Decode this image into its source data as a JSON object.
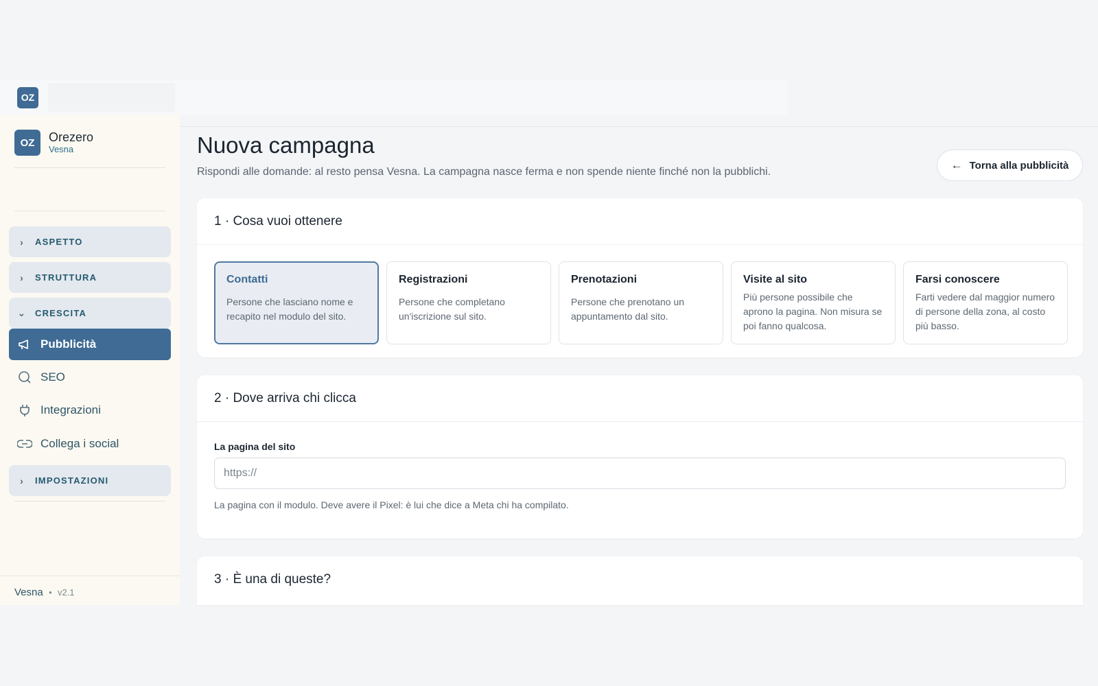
{
  "topbar": {
    "logo": "OZ"
  },
  "sidebar": {
    "brand": {
      "logo": "OZ",
      "name": "Orezero",
      "sub": "Vesna"
    },
    "groups": [
      {
        "label": "ASPETTO",
        "icon": "chevron-right-icon"
      },
      {
        "label": "STRUTTURA",
        "icon": "chevron-right-icon"
      },
      {
        "label": "CRESCITA",
        "icon": "chevron-down-icon"
      },
      {
        "label": "IMPOSTAZIONI",
        "icon": "chevron-right-icon"
      }
    ],
    "items": [
      {
        "label": "Pubblicità",
        "icon": "megaphone-icon",
        "active": true
      },
      {
        "label": "SEO",
        "icon": "search-icon"
      },
      {
        "label": "Integrazioni",
        "icon": "plug-icon"
      },
      {
        "label": "Collega i social",
        "icon": "link-icon"
      }
    ],
    "footer": {
      "app": "Vesna",
      "sep": "•",
      "version": "v2.1"
    }
  },
  "main": {
    "title": "Nuova campagna",
    "subtitle": "Rispondi alle domande: al resto pensa Vesna. La campagna nasce ferma e non spende niente finché non la pubblichi.",
    "back_button": "Torna alla pubblicità",
    "sections": [
      {
        "title": "1 · Cosa vuoi ottenere",
        "options": [
          {
            "title": "Contatti",
            "desc": "Persone che lasciano nome e recapito nel modulo del sito.",
            "selected": true
          },
          {
            "title": "Registrazioni",
            "desc": "Persone che completano un'iscrizione sul sito."
          },
          {
            "title": "Prenotazioni",
            "desc": "Persone che prenotano un appuntamento dal sito."
          },
          {
            "title": "Visite al sito",
            "desc": "Più persone possibile che aprono la pagina. Non misura se poi fanno qualcosa."
          },
          {
            "title": "Farsi conoscere",
            "desc": "Farti vedere dal maggior numero di persone della zona, al costo più basso."
          }
        ]
      },
      {
        "title": "2 · Dove arriva chi clicca",
        "field_label": "La pagina del sito",
        "placeholder": "https://",
        "help": "La pagina con il modulo. Deve avere il Pixel: è lui che dice a Meta chi ha compilato."
      },
      {
        "title": "3 · È una di queste?"
      }
    ]
  },
  "colors": {
    "accent": "#3f6b95",
    "sidebar_bg": "#fbf9f1",
    "group_bg": "#e4e8ef"
  }
}
